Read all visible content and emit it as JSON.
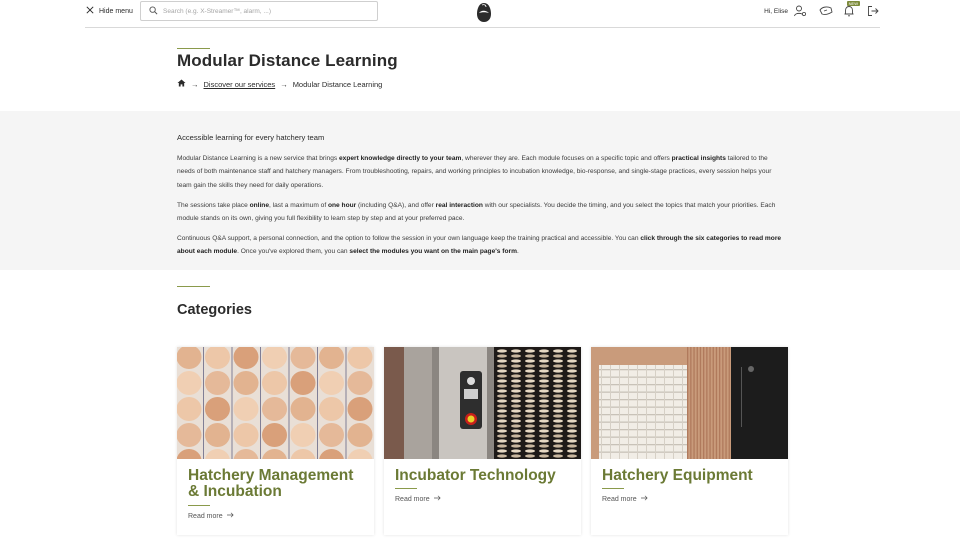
{
  "topbar": {
    "hide_menu_label": "Hide menu",
    "search_placeholder": "Search (e.g. X-Streamer™, alarm, ...)",
    "greeting": "Hi, Elise",
    "notification_badge": "NEW"
  },
  "header": {
    "title": "Modular Distance Learning",
    "breadcrumb": {
      "link": "Discover our services",
      "current": "Modular Distance Learning"
    }
  },
  "intro": {
    "lead": "Accessible learning for every hatchery team",
    "p1": [
      {
        "t": "Modular Distance Learning is a new service that brings ",
        "b": false
      },
      {
        "t": "expert knowledge directly to your team",
        "b": true
      },
      {
        "t": ", wherever they are. Each module focuses on a specific topic and offers ",
        "b": false
      },
      {
        "t": "practical insights",
        "b": true
      },
      {
        "t": " tailored to the needs of both maintenance staff and hatchery managers. From troubleshooting, repairs, and working principles to incubation knowledge, bio-response, and single-stage practices, every session helps your team gain the skills they need for daily operations.",
        "b": false
      }
    ],
    "p2": [
      {
        "t": "The sessions take place ",
        "b": false
      },
      {
        "t": "online",
        "b": true
      },
      {
        "t": ", last a maximum of ",
        "b": false
      },
      {
        "t": "one hour",
        "b": true
      },
      {
        "t": " (including Q&A), and offer ",
        "b": false
      },
      {
        "t": "real interaction",
        "b": true
      },
      {
        "t": " with our specialists. You decide the timing, and you select the topics that match your priorities. Each module stands on its own, giving you full flexibility to learn step by step and at your preferred pace.",
        "b": false
      }
    ],
    "p3": [
      {
        "t": "Continuous Q&A support, a personal connection, and the option to follow the session in your own language keep the training practical and accessible. You can ",
        "b": false
      },
      {
        "t": "click through the six categories to read more about each module",
        "b": true
      },
      {
        "t": ". Once you've explored them, you can ",
        "b": false
      },
      {
        "t": "select the modules you want on the main page's form",
        "b": true
      },
      {
        "t": ".",
        "b": false
      }
    ]
  },
  "categories": {
    "title": "Categories",
    "items": [
      {
        "title": "Hatchery Management & Incubation",
        "link": "Read more",
        "image": "eggs-tray"
      },
      {
        "title": "Incubator Technology",
        "link": "Read more",
        "image": "incubator-control-panel"
      },
      {
        "title": "Hatchery Equipment",
        "link": "Read more",
        "image": "egg-trolley"
      }
    ]
  },
  "colors": {
    "accent": "#6b7a35",
    "accent_rule": "#8a9a4b",
    "intro_bg": "#f5f5f5"
  }
}
